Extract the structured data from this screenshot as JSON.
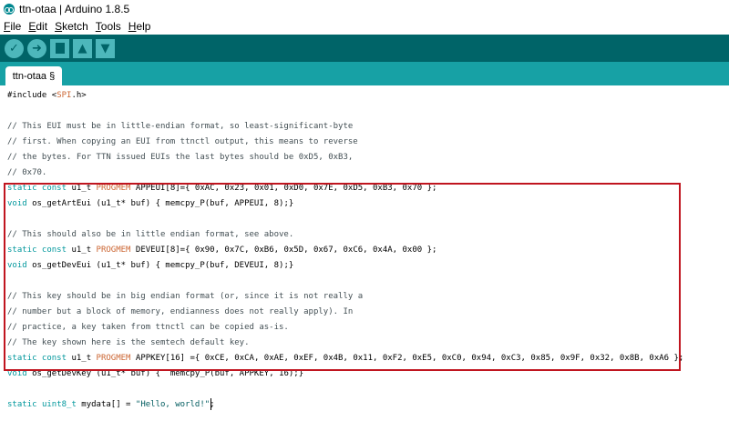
{
  "window": {
    "title": "ttn-otaa | Arduino 1.8.5"
  },
  "menu": [
    {
      "accel": "F",
      "rest": "ile"
    },
    {
      "accel": "E",
      "rest": "dit"
    },
    {
      "accel": "S",
      "rest": "ketch"
    },
    {
      "accel": "T",
      "rest": "ools"
    },
    {
      "accel": "H",
      "rest": "elp"
    }
  ],
  "toolbar": {
    "verify_icon": "check-icon",
    "upload_icon": "arrow-right-icon",
    "new_icon": "new-file-icon",
    "open_icon": "arrow-up-icon",
    "save_icon": "arrow-down-icon"
  },
  "tabs": [
    {
      "label": "ttn-otaa §"
    }
  ],
  "colors": {
    "toolbar": "#006468",
    "tabbar": "#17a1a5",
    "keyword": "#00979c",
    "highlight_box": "#c0151f"
  },
  "code": [
    "#include <SPI.h>",
    "",
    "// This EUI must be in little-endian format, so least-significant-byte",
    "// first. When copying an EUI from ttnctl output, this means to reverse",
    "// the bytes. For TTN issued EUIs the last bytes should be 0xD5, 0xB3,",
    "// 0x70.",
    "static const u1_t PROGMEM APPEUI[8]={ 0xAC, 0x23, 0x01, 0xD0, 0x7E, 0xD5, 0xB3, 0x70 };",
    "void os_getArtEui (u1_t* buf) { memcpy_P(buf, APPEUI, 8);}",
    "",
    "// This should also be in little endian format, see above.",
    "static const u1_t PROGMEM DEVEUI[8]={ 0x90, 0x7C, 0xB6, 0x5D, 0x67, 0xC6, 0x4A, 0x00 };",
    "void os_getDevEui (u1_t* buf) { memcpy_P(buf, DEVEUI, 8);}",
    "",
    "// This key should be in big endian format (or, since it is not really a",
    "// number but a block of memory, endianness does not really apply). In",
    "// practice, a key taken from ttnctl can be copied as-is.",
    "// The key shown here is the semtech default key.",
    "static const u1_t PROGMEM APPKEY[16] ={ 0xCE, 0xCA, 0xAE, 0xEF, 0x4B, 0x11, 0xF2, 0xE5, 0xC0, 0x94, 0xC3, 0x85, 0x9F, 0x32, 0x8B, 0xA6 };",
    "void os_getDevKey (u1_t* buf) {  memcpy_P(buf, APPKEY, 16);}",
    "",
    "static uint8_t mydata[] = \"Hello, world!\";"
  ]
}
